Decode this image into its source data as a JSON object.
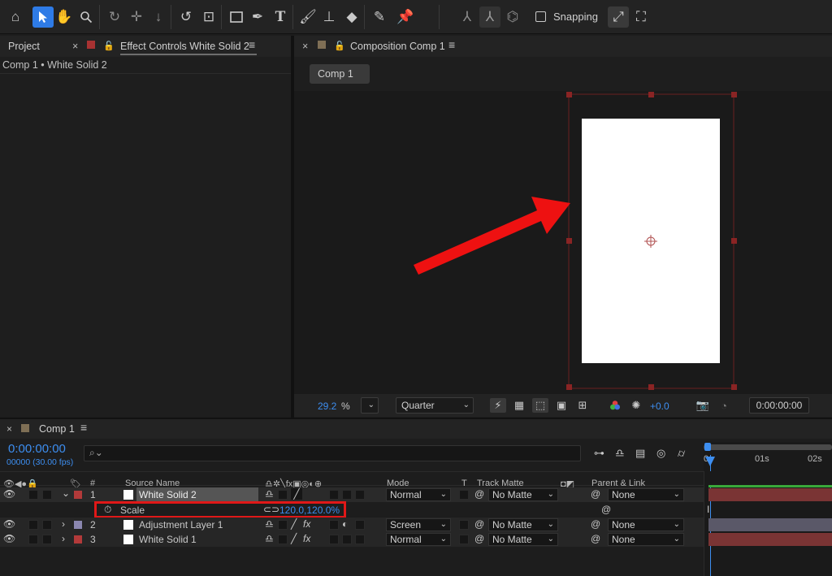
{
  "toolbar": {
    "tools": [
      "home-icon",
      "selection-icon",
      "hand-icon",
      "zoom-icon",
      "orbit-icon",
      "pan-icon",
      "dolly-icon",
      "rotate-icon",
      "anchor-icon",
      "rectangle-icon",
      "pen-icon",
      "type-icon",
      "brush-icon",
      "clone-stamp-icon",
      "eraser-icon",
      "roto-brush-icon",
      "puppet-pin-icon"
    ],
    "snapping_label": "Snapping"
  },
  "left_panel": {
    "tab_project": "Project",
    "tab_effect_controls": "Effect Controls White Solid 2",
    "breadcrumb": "Comp 1 • White Solid 2"
  },
  "composition_panel": {
    "tab_label": "Composition Comp 1",
    "comp_button": "Comp 1",
    "zoom_value": "29.2",
    "zoom_unit": "%",
    "resolution": "Quarter",
    "exposure": "+0.0",
    "timecode": "0:00:00:00"
  },
  "timeline": {
    "tab_label": "Comp 1",
    "timecode": "0:00:00:00",
    "frame_info": "00000 (30.00 fps)",
    "search_placeholder": "",
    "columns": {
      "number": "#",
      "source_name": "Source Name",
      "mode": "Mode",
      "t": "T",
      "track_matte": "Track Matte",
      "parent_link": "Parent & Link"
    },
    "ruler": [
      "0s",
      "01s",
      "02s"
    ],
    "layers": [
      {
        "index": "1",
        "name": "White Solid 2",
        "color": "#b33a3a",
        "mode": "Normal",
        "matte": "No Matte",
        "parent": "None"
      },
      {
        "index": "2",
        "name": "Adjustment Layer 1",
        "color": "#8b87b0",
        "mode": "Screen",
        "matte": "No Matte",
        "parent": "None"
      },
      {
        "index": "3",
        "name": "White Solid 1",
        "color": "#b33a3a",
        "mode": "Normal",
        "matte": "No Matte",
        "parent": "None"
      }
    ],
    "property": {
      "name": "Scale",
      "value": "120.0,120.0%"
    }
  },
  "colors": {
    "accent_blue": "#2e7be6",
    "highlight_red": "#e01818",
    "layer_bar_red": "#7a3434",
    "layer_bar_purple": "#5a5868"
  }
}
